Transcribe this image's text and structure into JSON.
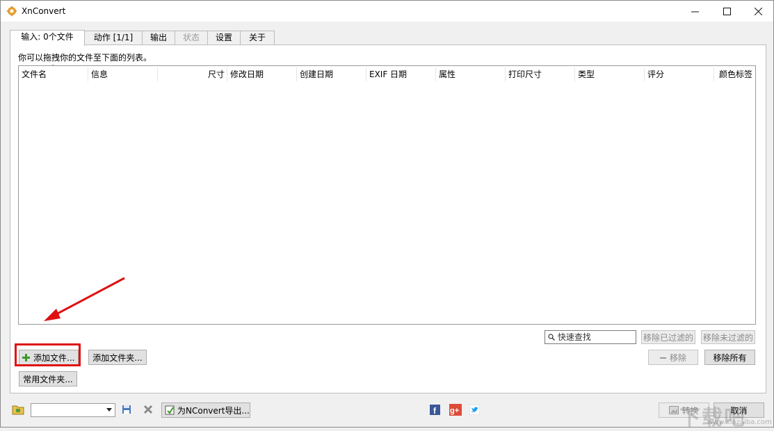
{
  "window": {
    "title": "XnConvert"
  },
  "tabs": [
    {
      "label": "输入: 0个文件",
      "active": true
    },
    {
      "label": "动作 [1/1]"
    },
    {
      "label": "输出"
    },
    {
      "label": "状态",
      "disabled": true
    },
    {
      "label": "设置"
    },
    {
      "label": "关于"
    }
  ],
  "input": {
    "hint": "你可以拖拽你的文件至下面的列表。",
    "columns": [
      "文件名",
      "信息",
      "尺寸",
      "修改日期",
      "创建日期",
      "EXIF 日期",
      "属性",
      "打印尺寸",
      "类型",
      "评分",
      "颜色标签"
    ]
  },
  "buttons": {
    "add_files": "添加文件...",
    "add_folder": "添加文件夹...",
    "common_folders": "常用文件夹...",
    "remove_filtered": "移除已过滤的",
    "remove_unfiltered": "移除未过滤的",
    "remove": "移除",
    "remove_all": "移除所有",
    "export_nconvert": "为NConvert导出...",
    "convert": "转换",
    "cancel": "取消"
  },
  "search": {
    "placeholder": "快速查找"
  },
  "watermark": {
    "text": "下载吧",
    "url": "www.xiazaiba.com"
  },
  "colors": {
    "highlight": "#e01010",
    "facebook": "#3b5998",
    "google_plus": "#dd4b39",
    "twitter": "#1da1f2"
  }
}
